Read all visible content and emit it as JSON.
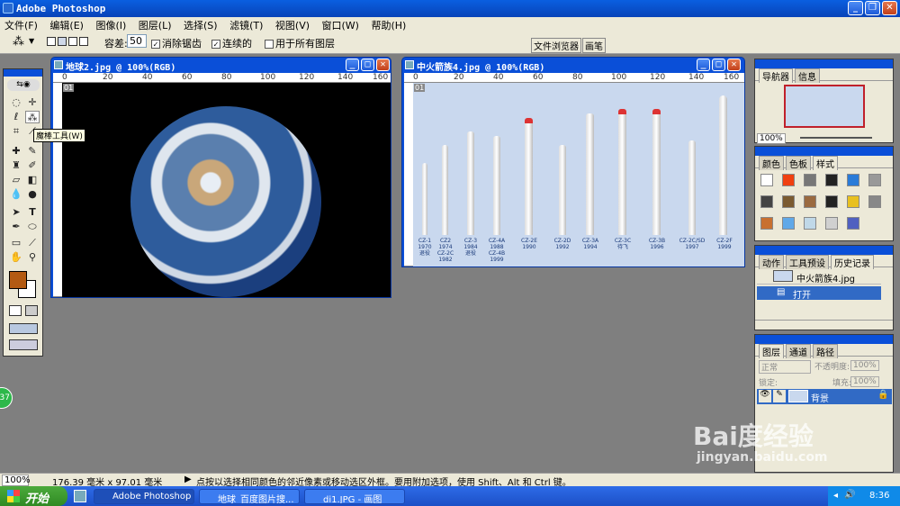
{
  "app": {
    "title": "Adobe Photoshop"
  },
  "menu": [
    "文件(F)",
    "编辑(E)",
    "图像(I)",
    "图层(L)",
    "选择(S)",
    "滤镜(T)",
    "视图(V)",
    "窗口(W)",
    "帮助(H)"
  ],
  "options": {
    "tolerance_label": "容差:",
    "tolerance_value": "50",
    "antialias": "消除锯齿",
    "contiguous": "连续的",
    "all_layers": "用于所有图层",
    "file_browser_tab": "文件浏览器",
    "brushes_tab": "画笔"
  },
  "toolbox": {
    "tooltip": "魔棒工具(W)",
    "fg_color": "#b35a12",
    "bg_color": "#ffffff"
  },
  "doc1": {
    "title": "地球2.jpg @ 100%(RGB)",
    "ruler_labels": [
      "0",
      "20",
      "40",
      "60",
      "80",
      "100",
      "120",
      "140",
      "160"
    ],
    "marker": "01"
  },
  "doc2": {
    "title": "中火箭族4.jpg @ 100%(RGB)",
    "ruler_labels": [
      "0",
      "20",
      "40",
      "60",
      "80",
      "100",
      "120",
      "140",
      "160"
    ],
    "marker": "01",
    "rockets": [
      {
        "name": "CZ-1",
        "year": "1970",
        "note": "退役"
      },
      {
        "name": "CZ2",
        "year": "1974",
        "note": "CZ-2C 1982"
      },
      {
        "name": "CZ-3",
        "year": "1984",
        "note": "退役"
      },
      {
        "name": "CZ-4A",
        "year": "1988",
        "note": "CZ-4B 1999"
      },
      {
        "name": "CZ-2E",
        "year": "1990",
        "note": ""
      },
      {
        "name": "CZ-2D",
        "year": "1992",
        "note": ""
      },
      {
        "name": "CZ-3A",
        "year": "1994",
        "note": ""
      },
      {
        "name": "CZ-3C",
        "year": "待飞",
        "note": ""
      },
      {
        "name": "CZ-3B",
        "year": "1996",
        "note": ""
      },
      {
        "name": "CZ-2C/SD",
        "year": "1997",
        "note": ""
      },
      {
        "name": "CZ-2F",
        "year": "1999",
        "note": ""
      }
    ]
  },
  "navigator": {
    "tabs": [
      "导航器",
      "信息"
    ],
    "zoom": "100%"
  },
  "swatches": {
    "tabs": [
      "颜色",
      "色板",
      "样式"
    ],
    "colors": [
      "#ffffff",
      "#f04010",
      "#777777",
      "#222222",
      "#2a7bd8",
      "#999999",
      "#444444",
      "#7a5a30",
      "#9a6a40",
      "#222222",
      "#e8c020",
      "#888888",
      "#c87030",
      "#60a8e8",
      "#c0d8e8",
      "#d0d0d0",
      "#5060c0",
      "#aaaaaa"
    ]
  },
  "history": {
    "tabs": [
      "动作",
      "工具预设",
      "历史记录"
    ],
    "snapshot": "中火箭族4.jpg",
    "item": "打开"
  },
  "layers": {
    "tabs": [
      "图层",
      "通道",
      "路径"
    ],
    "mode": "正常",
    "opacity_label": "不透明度:",
    "opacity_value": "100%",
    "lock_label": "锁定:",
    "fill_label": "填充:",
    "fill_value": "100%",
    "layer_name": "背景"
  },
  "status": {
    "zoom": "100%",
    "dimensions": "176.39 毫米 x 97.01 毫米",
    "hint": "点按以选择相同颜色的邻近像素或移动选区外框。要用附加选项，使用 Shift、Alt 和 Ctrl 键。"
  },
  "side_badge": "37",
  "taskbar": {
    "start": "开始",
    "tasks": [
      "Adobe Photoshop",
      "地球_百度图片搜...",
      "di1.JPG - 画图"
    ],
    "time": "8:36"
  },
  "watermark": {
    "brand": "Bai度经验",
    "url": "jingyan.baidu.com"
  }
}
